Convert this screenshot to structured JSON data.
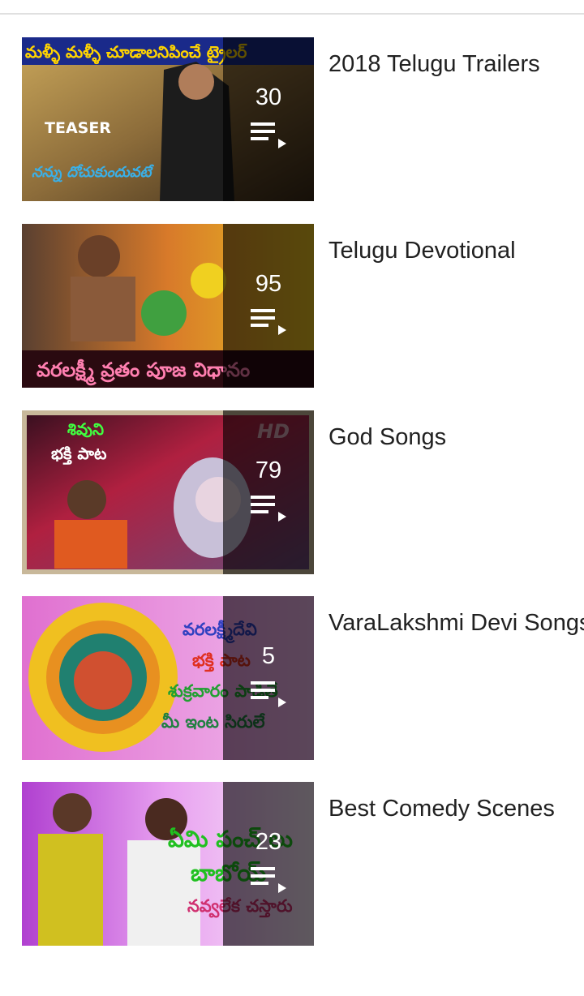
{
  "playlists": [
    {
      "title": "2018 Telugu Trailers",
      "count": "30",
      "thumb_caption_top": "మళ్ళీ మళ్ళీ చూడాలనిపించే ట్రైలర్",
      "thumb_badge": "TEASER",
      "thumb_script": "నన్ను దోచుకుందువటే",
      "icon": "playlist-play-icon"
    },
    {
      "title": "Telugu Devotional",
      "count": "95",
      "thumb_caption_bottom": "వరలక్ష్మీ వ్రతం పూజ విధానం",
      "icon": "playlist-play-icon"
    },
    {
      "title": "God Songs",
      "count": "79",
      "thumb_line1": "శివుని",
      "thumb_line2": "భక్తి పాట",
      "thumb_badge": "HD",
      "icon": "playlist-play-icon"
    },
    {
      "title": "VaraLakshmi Devi Songs",
      "count": "5",
      "thumb_line1": "వరలక్ష్మీదేవి",
      "thumb_line2": "భక్తి పాట",
      "thumb_line3": "శుక్రవారం పాడితే",
      "thumb_line4": "మీ ఇంట సిరులే",
      "icon": "playlist-play-icon"
    },
    {
      "title": "Best Comedy Scenes",
      "count": "23",
      "thumb_line1": "ఏమి పంచ్ లు",
      "thumb_line2": "బాబోయ్",
      "thumb_line3": "నవ్వలేక చస్తారు",
      "icon": "playlist-play-icon"
    }
  ],
  "colors": {
    "overlay": "rgba(0,0,0,0.62)",
    "title": "#212121",
    "count": "#ffffff",
    "divider": "#e0e0e0"
  }
}
